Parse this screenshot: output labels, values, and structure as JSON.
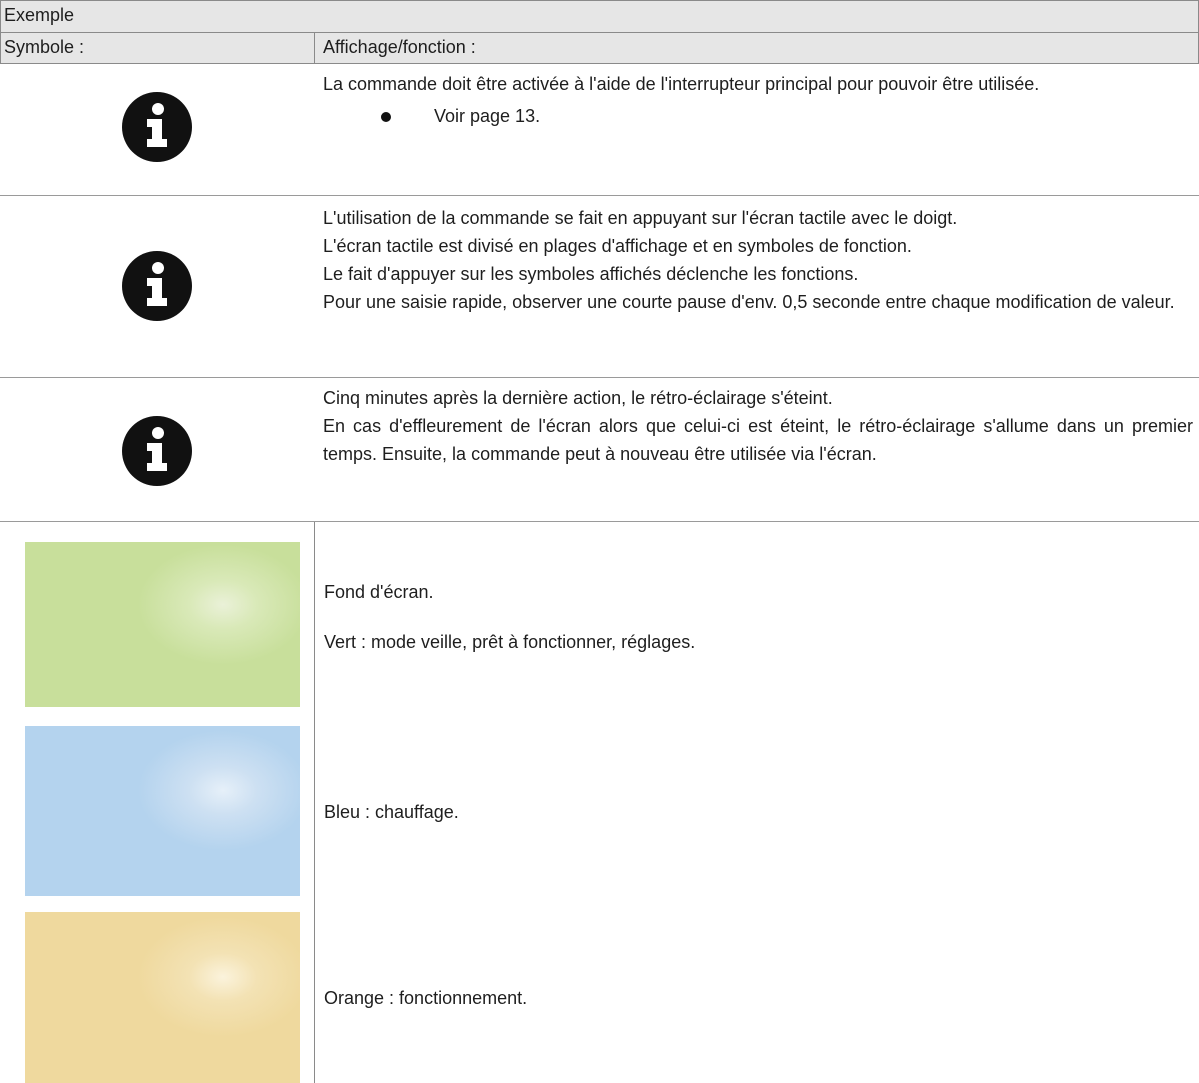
{
  "header": {
    "example_label": "Exemple",
    "col_symbol": "Symbole :",
    "col_display": "Affichage/fonction :"
  },
  "info_rows": [
    {
      "icon": "info-icon",
      "lines": [
        "La commande doit être activée à l'aide de l'interrupteur principal pour pouvoir être utilisée."
      ],
      "bullet": "Voir page 13."
    },
    {
      "icon": "info-icon",
      "lines": [
        "L'utilisation de la commande se fait en appuyant sur l'écran tactile avec le doigt.",
        "L'écran tactile est divisé en plages d'affichage et en symboles de fonction.",
        "Le fait d'appuyer sur les symboles affichés déclenche les fonctions.",
        "Pour une saisie rapide, observer une courte pause d'env. 0,5 seconde entre chaque modification de valeur."
      ]
    },
    {
      "icon": "info-icon",
      "lines": [
        "Cinq minutes après la dernière action, le rétro-éclairage s'éteint.",
        "En cas d'effleurement de l'écran alors que celui-ci est éteint, le rétro-éclairage s'allume dans un premier temps. Ensuite, la commande peut à nouveau être utilisée via l'écran."
      ]
    }
  ],
  "colors": {
    "background_label": "Fond d'écran.",
    "green_text": "Vert : mode veille, prêt à fonctionner, réglages.",
    "blue_text": "Bleu : chauffage.",
    "orange_text": "Orange : fonctionnement.",
    "green": "#c8df9b",
    "blue": "#b4d3ee",
    "orange": "#efd99e"
  }
}
